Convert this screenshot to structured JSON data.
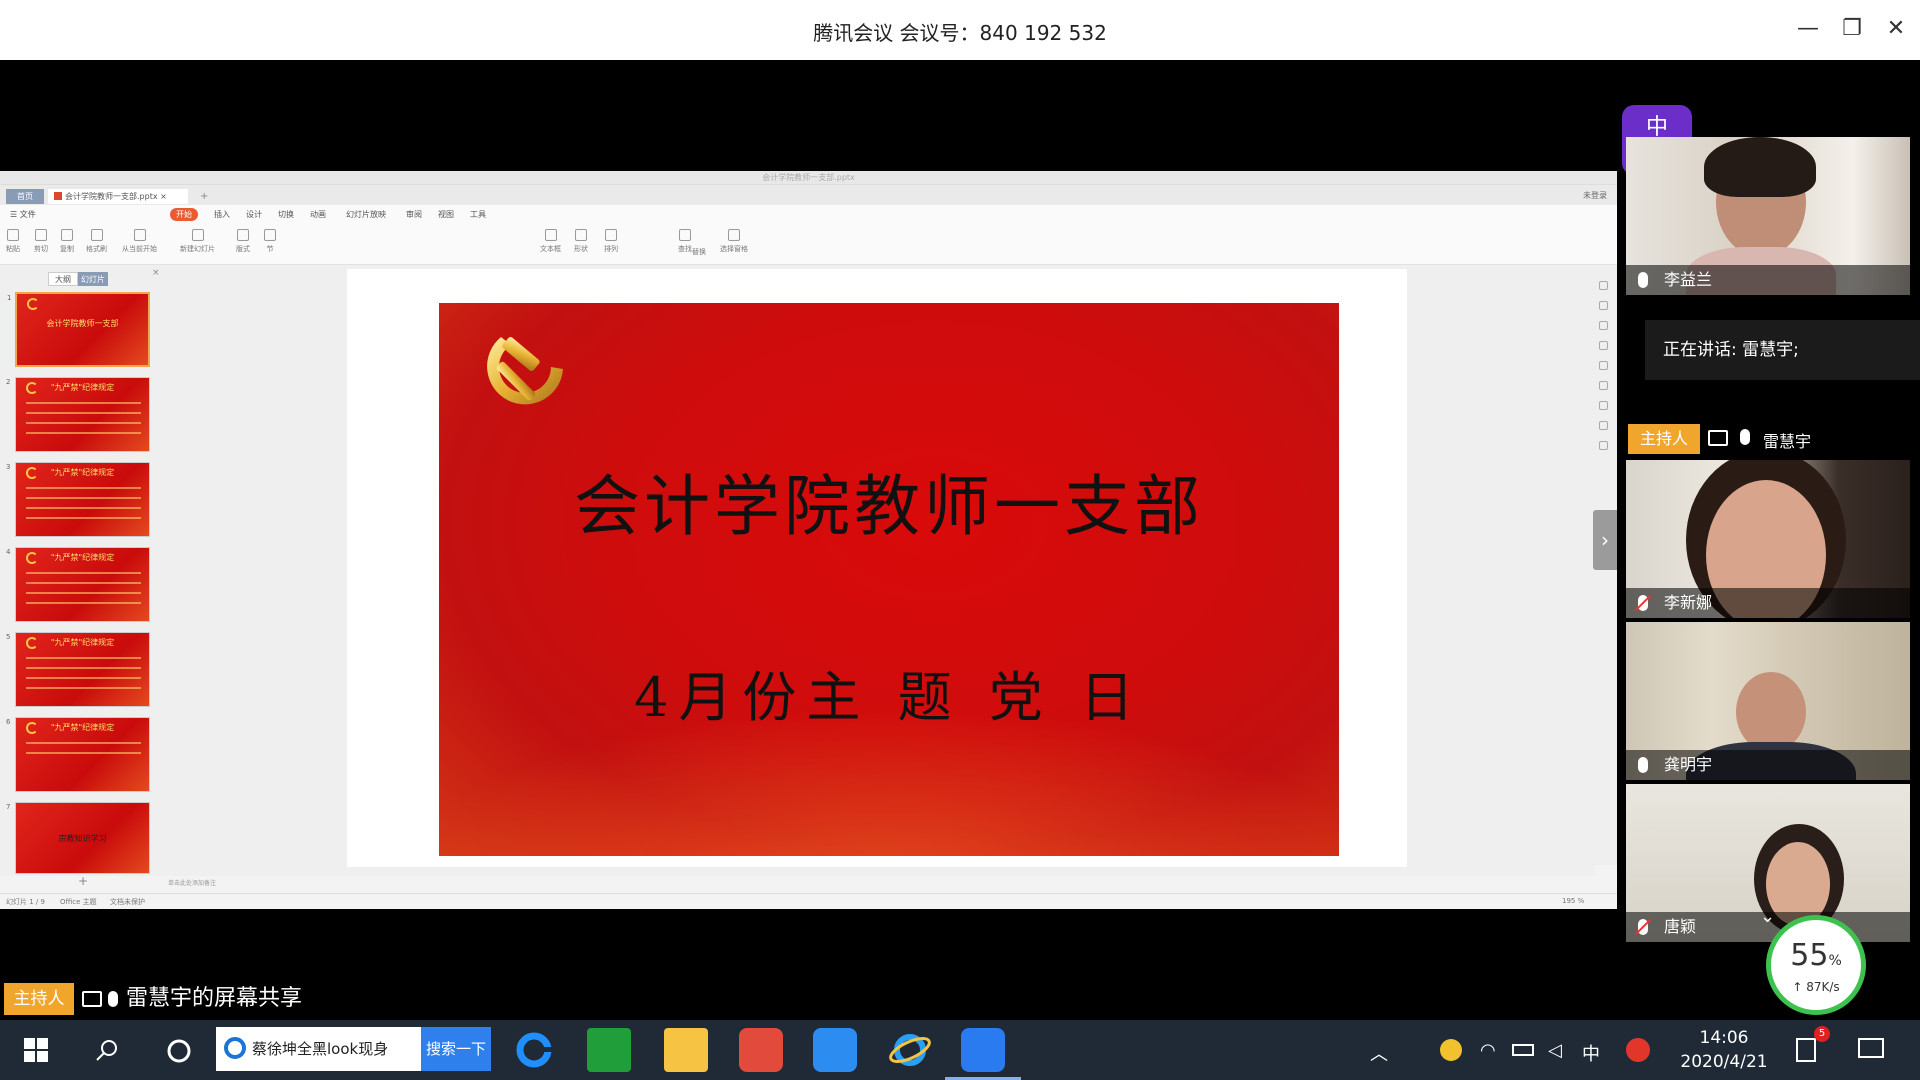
{
  "window": {
    "title": "腾讯会议 会议号：840 192 532",
    "minimize": "—",
    "maximize": "❐",
    "close": "✕"
  },
  "ppt": {
    "doc_title": "会计学院教师一支部.pptx",
    "tabs": {
      "home": "首页",
      "file": "会计学院教师一支部.pptx ×",
      "new": "+"
    },
    "login": "未登录",
    "menu": [
      "☰ 文件",
      "开始",
      "插入",
      "设计",
      "切换",
      "动画",
      "幻灯片放映",
      "审阅",
      "视图",
      "工具"
    ],
    "ribbon": [
      "粘贴",
      "剪切",
      "复制",
      "格式刷",
      "从当前开始",
      "新建幻灯片",
      "版式",
      "节",
      "文本框",
      "形状",
      "排列",
      "查找",
      "替换",
      "选择窗格"
    ],
    "view_tabs": [
      "大纲",
      "幻灯片"
    ],
    "panel_close": "×",
    "thumbs": [
      {
        "num": "1",
        "title": "会计学院教师一支部"
      },
      {
        "num": "2",
        "title": "\"九严禁\"纪律规定"
      },
      {
        "num": "3",
        "title": "\"九严禁\"纪律规定"
      },
      {
        "num": "4",
        "title": "\"九严禁\"纪律规定"
      },
      {
        "num": "5",
        "title": "\"九严禁\"纪律规定"
      },
      {
        "num": "6",
        "title": "\"九严禁\"纪律规定"
      },
      {
        "num": "7",
        "title": "宗教知识学习"
      }
    ],
    "add_slide": "+",
    "notes_hint": "单击此处添加备注",
    "slide": {
      "title": "会计学院教师一支部",
      "subtitle": "4月份主 题 党 日"
    },
    "next_arrow": "›",
    "status": {
      "page": "幻灯片 1 / 9",
      "theme": "Office 主题",
      "protect": "文档未保护",
      "zoom": "195 %"
    }
  },
  "participants": {
    "ime_badge": "中",
    "ime_sub": "☽ ✦",
    "speaking": "正在讲话: 雷慧宇;",
    "host_tag": "主持人",
    "host_name": "雷慧宇",
    "videos": [
      {
        "name": "李益兰",
        "muted": false
      },
      {
        "name": "李新娜",
        "muted": true
      },
      {
        "name": "龚明宇",
        "muted": false
      },
      {
        "name": "唐颖",
        "muted": true
      }
    ],
    "collapse": "⌄"
  },
  "network": {
    "percent": "55",
    "percent_unit": "%",
    "rate": "↑ 87K/s"
  },
  "share_label": {
    "host": "主持人",
    "text": "雷慧宇的屏幕共享"
  },
  "taskbar": {
    "search_text": "蔡徐坤全黑look现身",
    "search_button": "搜索一下",
    "ime": "中",
    "time": "14:06",
    "date": "2020/4/21",
    "notif_count": "5"
  }
}
